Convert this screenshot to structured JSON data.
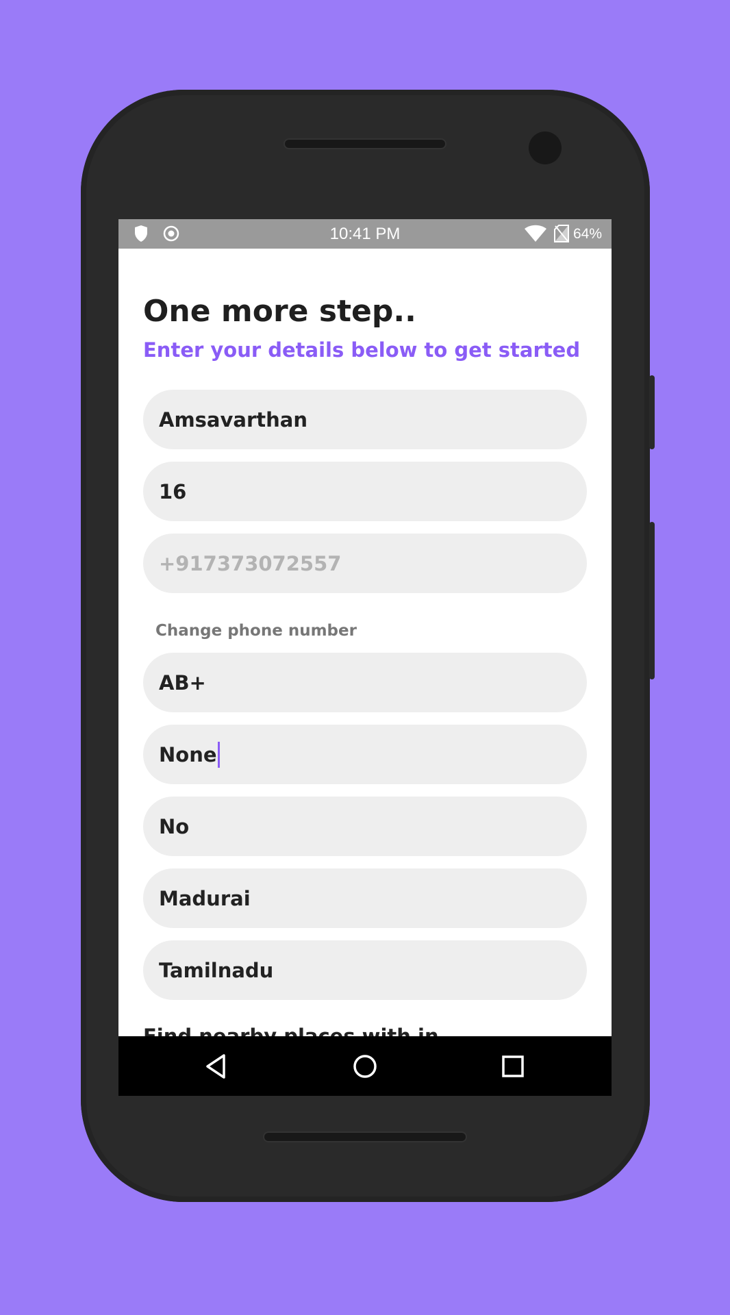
{
  "status_bar": {
    "time": "10:41 PM",
    "battery": "64%",
    "icons": [
      "shield-icon",
      "record-icon",
      "wifi-icon",
      "no-sim-icon"
    ]
  },
  "header": {
    "title": "One more step..",
    "subtitle": "Enter your details below to get started"
  },
  "form": {
    "name": "Amsavarthan",
    "age": "16",
    "phone": "+917373072557",
    "change_phone_label": "Change phone number",
    "blood_group": "AB+",
    "medical_condition": "None",
    "donated_before": "No",
    "city": "Madurai",
    "state": "Tamilnadu",
    "next_section_label": "Find nearby places with in"
  },
  "nav_bar": {
    "icons": [
      "back-icon",
      "home-icon",
      "recents-icon"
    ]
  },
  "colors": {
    "background": "#9a7bf8",
    "accent": "#8a5cf6",
    "field_bg": "#eeeeee"
  }
}
